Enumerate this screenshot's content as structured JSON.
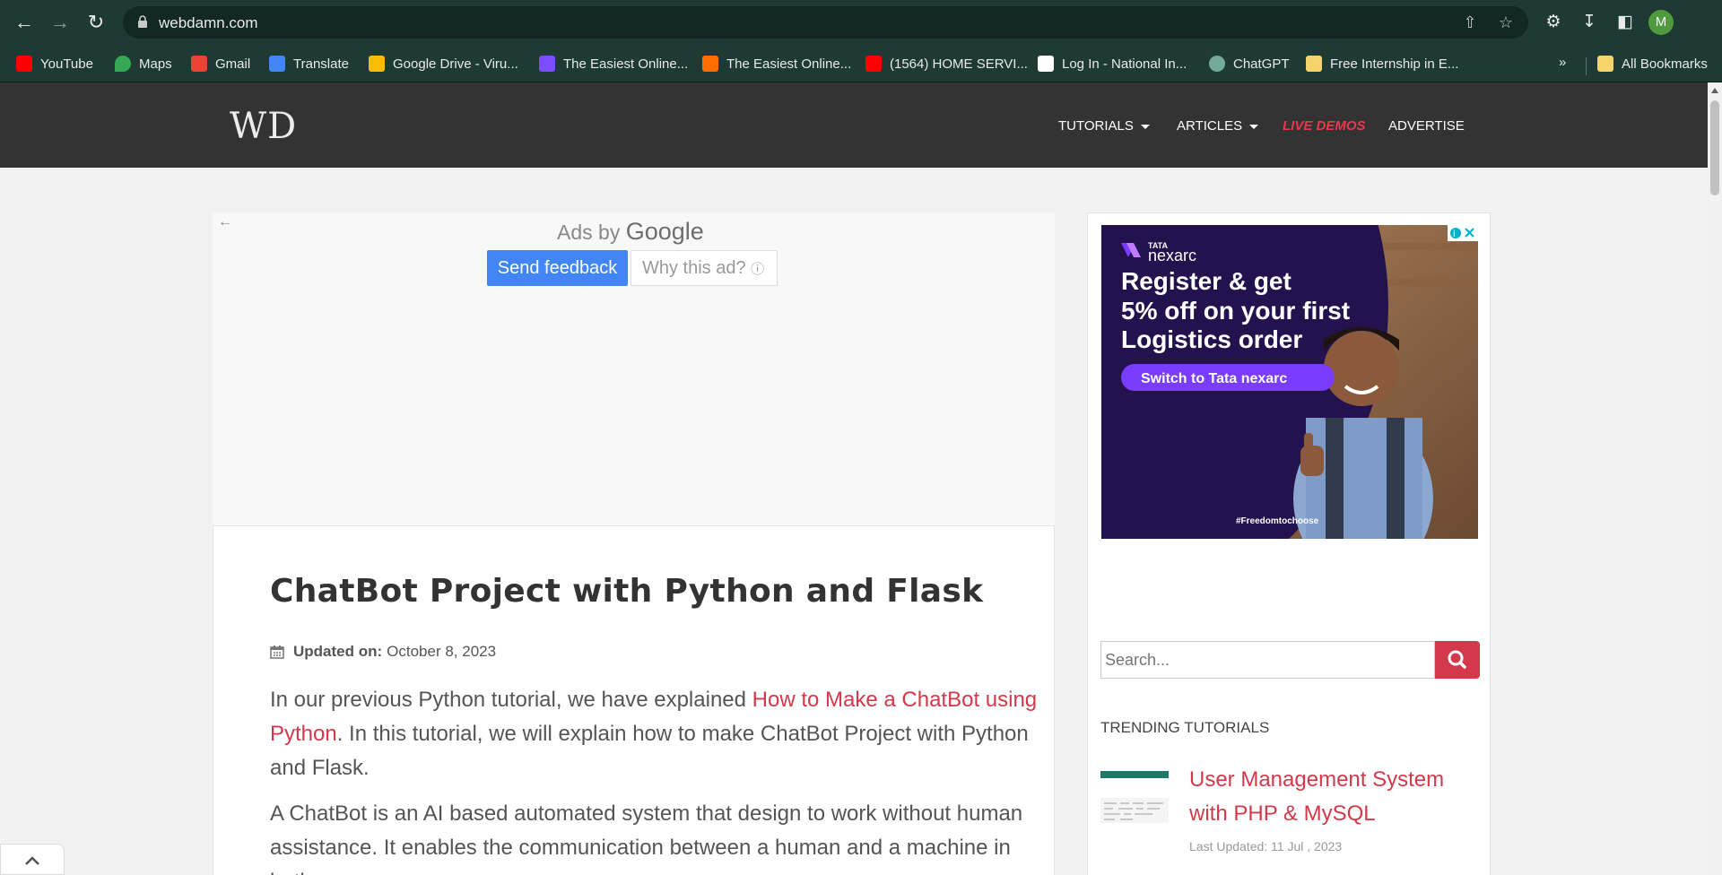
{
  "browser": {
    "url": "webdamn.com",
    "avatar_letter": "M",
    "bookmarks": [
      {
        "label": "YouTube",
        "icon": "youtube-icon",
        "color": "#ff0000"
      },
      {
        "label": "Maps",
        "icon": "maps-icon",
        "color": "#34a853"
      },
      {
        "label": "Gmail",
        "icon": "gmail-icon",
        "color": "#ea4335"
      },
      {
        "label": "Translate",
        "icon": "translate-icon",
        "color": "#4285f4"
      },
      {
        "label": "Google Drive - Viru...",
        "icon": "drive-icon",
        "color": "#fbbc04"
      },
      {
        "label": "The Easiest Online...",
        "icon": "easiest-icon",
        "color": "#7c4dff"
      },
      {
        "label": "The Easiest Online...",
        "icon": "easiest-orange-icon",
        "color": "#ff6d00"
      },
      {
        "label": "(1564) HOME SERVI...",
        "icon": "youtube-icon",
        "color": "#ff0000"
      },
      {
        "label": "Log In - National In...",
        "icon": "ni-icon",
        "color": "#ffffff"
      },
      {
        "label": "ChatGPT",
        "icon": "chatgpt-icon",
        "color": "#74aa9c"
      },
      {
        "label": "Free Internship in E...",
        "icon": "folder-doc-icon",
        "color": "#f6d36b"
      }
    ],
    "bookmarks_more": "»",
    "all_bookmarks": "All Bookmarks"
  },
  "site": {
    "logo": "WD",
    "menu": [
      {
        "label": "TUTORIALS",
        "has_dropdown": true
      },
      {
        "label": "ARTICLES",
        "has_dropdown": true
      },
      {
        "label": "LIVE DEMOS",
        "has_dropdown": false
      },
      {
        "label": "ADVERTISE",
        "has_dropdown": false
      }
    ],
    "accent_color": "#d4394b"
  },
  "ad": {
    "ads_by": "Ads by",
    "google": "Google",
    "send_feedback": "Send feedback",
    "why_this_ad": "Why this ad?"
  },
  "article": {
    "title": "ChatBot Project with Python and Flask",
    "updated_label": "Updated on:",
    "updated_date": "October 8, 2023",
    "para1_before": "In our previous Python tutorial, we have explained ",
    "para1_link": "How to Make a ChatBot using Python",
    "para1_after": ". In this tutorial, we will explain how to make ChatBot Project with Python and Flask.",
    "para2": "A ChatBot is an AI based automated system that design to work without human assistance. It enables the communication between a human and a machine in both"
  },
  "sidebar_ad": {
    "brand_small": "TATA",
    "brand": "nexarc",
    "headline_lines": [
      "Register & get",
      "5% off on your first",
      "Logistics order"
    ],
    "cta": "Switch to Tata nexarc",
    "hashtag": "#Freedomtochoose"
  },
  "sidebar": {
    "search_placeholder": "Search...",
    "trending_title": "TRENDING TUTORIALS",
    "trending": [
      {
        "title": "User Management System with PHP & MySQL",
        "date": "Last Updated: 11 Jul , 2023"
      }
    ]
  }
}
